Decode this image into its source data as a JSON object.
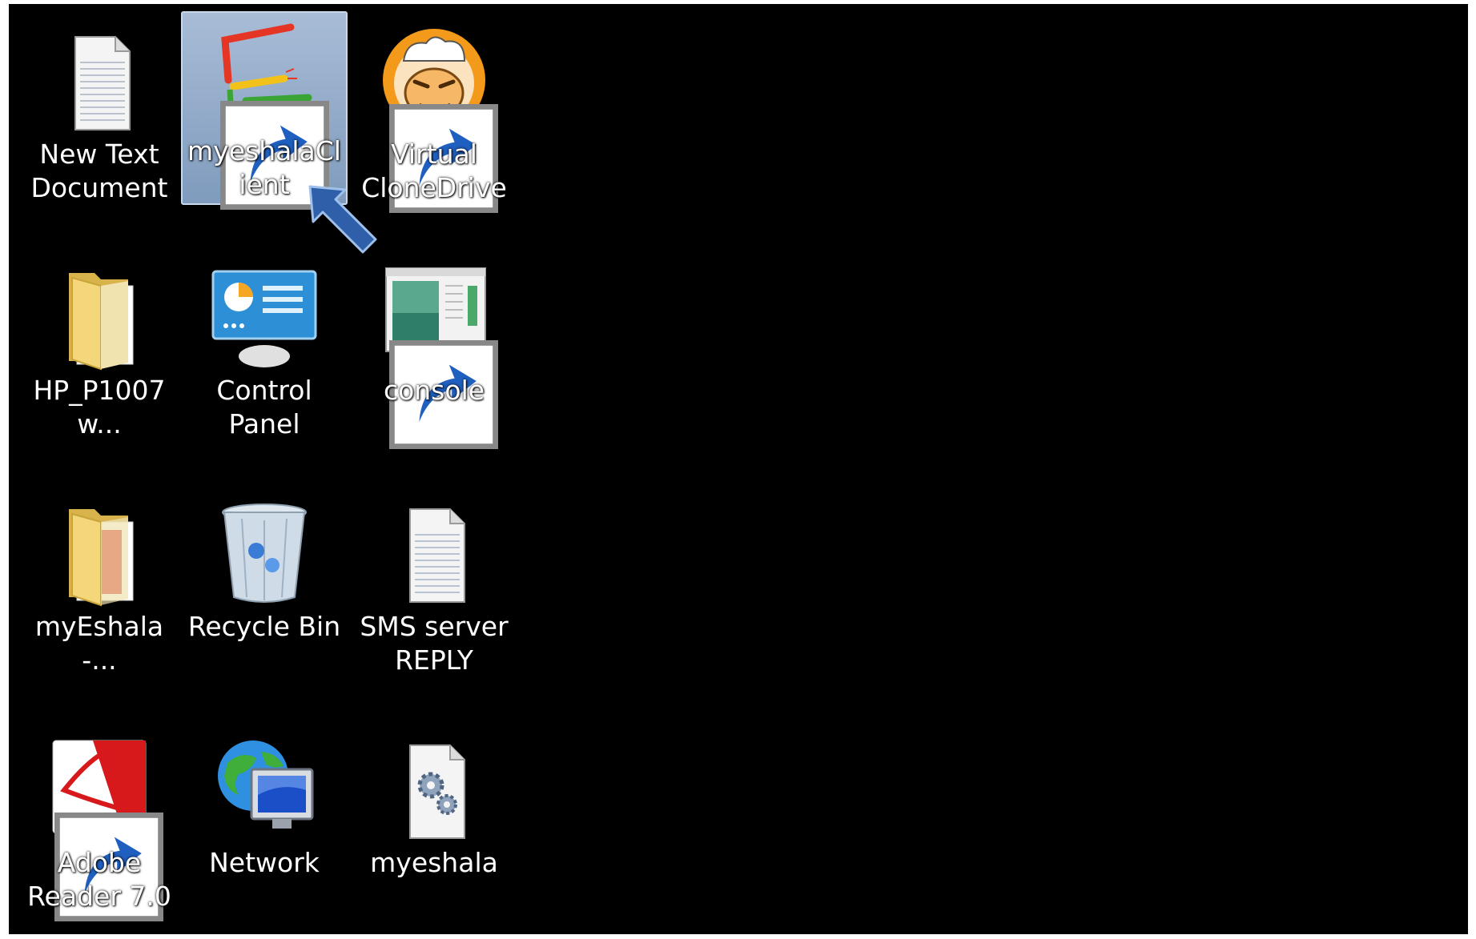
{
  "desktop": {
    "icons": [
      {
        "label": "New Text\nDocument",
        "icon": "text-document-icon",
        "shortcut": false,
        "selected": false
      },
      {
        "label": "myeshalaClient",
        "icon": "myeshala-client-icon",
        "shortcut": true,
        "selected": true
      },
      {
        "label": "Virtual\nCloneDrive",
        "icon": "virtual-clonedrive-sheep-icon",
        "shortcut": true,
        "selected": false
      },
      {
        "label": "HP_P1007w...",
        "icon": "folder-icon",
        "shortcut": false,
        "selected": false
      },
      {
        "label": "Control\nPanel",
        "icon": "control-panel-icon",
        "shortcut": false,
        "selected": false
      },
      {
        "label": "console",
        "icon": "console-window-icon",
        "shortcut": true,
        "selected": false
      },
      {
        "label": "myEshala-...",
        "icon": "folder-with-document-icon",
        "shortcut": false,
        "selected": false
      },
      {
        "label": "Recycle Bin",
        "icon": "recycle-bin-icon",
        "shortcut": false,
        "selected": false
      },
      {
        "label": "SMS server\nREPLY",
        "icon": "text-document-icon",
        "shortcut": false,
        "selected": false
      },
      {
        "label": "Adobe\nReader 7.0",
        "icon": "adobe-reader-icon",
        "shortcut": true,
        "selected": false
      },
      {
        "label": "Network",
        "icon": "network-globe-icon",
        "shortcut": false,
        "selected": false
      },
      {
        "label": "myeshala",
        "icon": "config-file-gears-icon",
        "shortcut": false,
        "selected": false
      }
    ],
    "annotation": {
      "icon": "blue-pointer-arrow-icon",
      "color": "#2e5fa8"
    }
  },
  "colors": {
    "desktop_background": "#000000",
    "selection": "#8fa9c9",
    "label_text": "#ffffff"
  }
}
